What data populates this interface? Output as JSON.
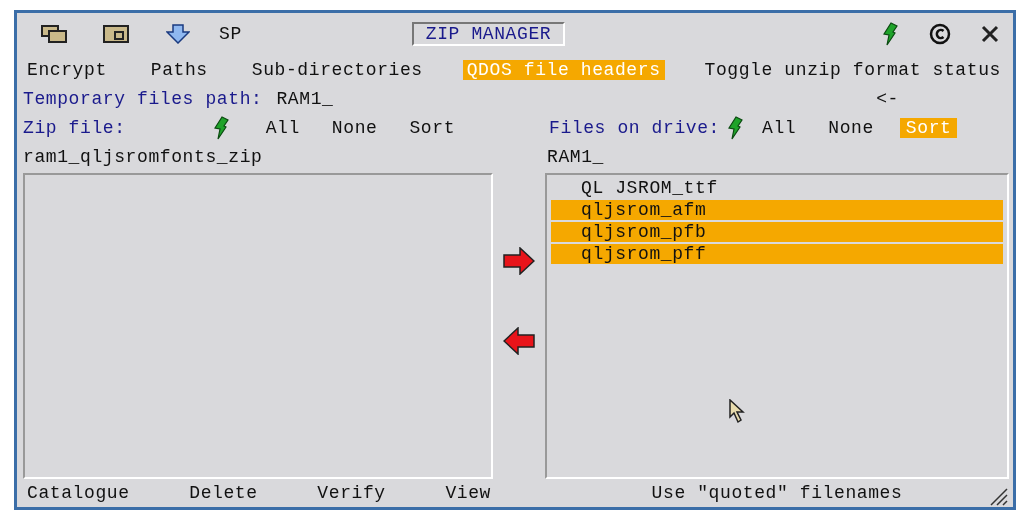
{
  "window": {
    "title": "ZIP MANAGER",
    "toolbar": [
      {
        "kind": "icon"
      },
      {
        "kind": "icon"
      },
      {
        "kind": "icon"
      },
      {
        "kind": "text",
        "label": "SP"
      }
    ]
  },
  "menu": [
    {
      "label": "Encrypt",
      "selected": false
    },
    {
      "label": "Paths",
      "selected": false
    },
    {
      "label": "Sub-directories",
      "selected": false
    },
    {
      "label": "QDOS file headers",
      "selected": true
    },
    {
      "label": "Toggle unzip format status",
      "selected": false
    }
  ],
  "temporary_path": {
    "label": "Temporary files path:",
    "value": "RAM1_",
    "back": "<-"
  },
  "zip_panel": {
    "label": "Zip file:",
    "actions": [
      {
        "label": "All",
        "selected": false
      },
      {
        "label": "None",
        "selected": false
      },
      {
        "label": "Sort",
        "selected": false
      }
    ],
    "path": "ram1_qljsromfonts_zip",
    "buttons": [
      "Catalogue",
      "Delete",
      "Verify",
      "View"
    ]
  },
  "drive_panel": {
    "label": "Files on drive:",
    "actions": [
      {
        "label": "All",
        "selected": false
      },
      {
        "label": "None",
        "selected": false
      },
      {
        "label": "Sort",
        "selected": true
      }
    ],
    "path": "RAM1_",
    "files": [
      {
        "name": "QL JSROM_ttf",
        "selected": false
      },
      {
        "name": "qljsrom_afm",
        "selected": true
      },
      {
        "name": "qljsrom_pfb",
        "selected": true
      },
      {
        "name": "qljsrom_pff",
        "selected": true
      }
    ],
    "buttons": [
      "Use \"quoted\" filenames"
    ]
  }
}
